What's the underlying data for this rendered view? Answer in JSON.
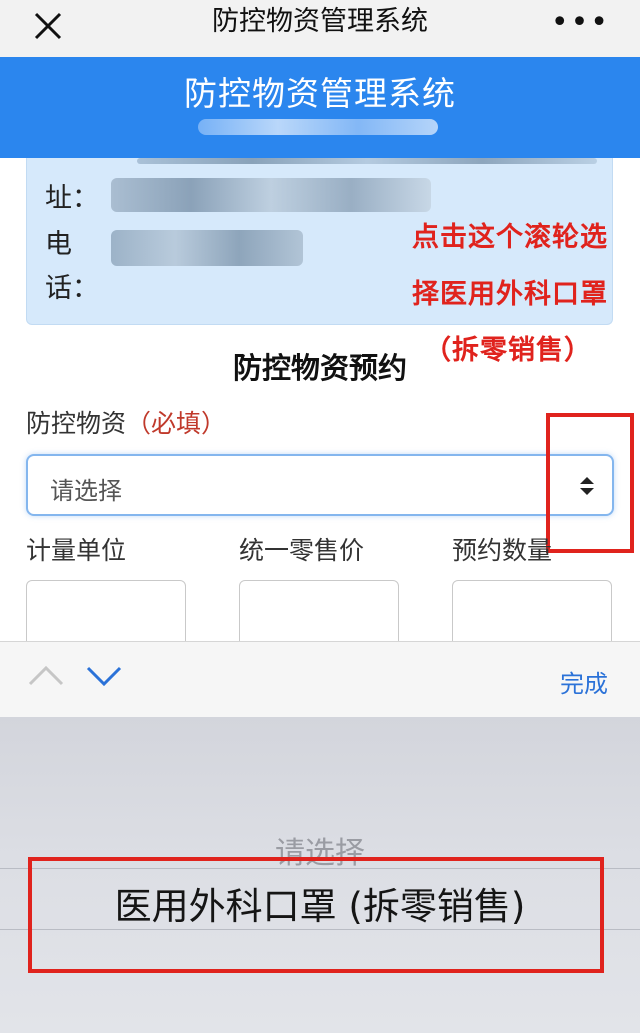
{
  "topbar": {
    "title": "防控物资管理系统",
    "more_label": "•••"
  },
  "header": {
    "title": "防控物资管理系统"
  },
  "card": {
    "labels": [
      "址：",
      "电",
      "话："
    ]
  },
  "annotation": {
    "lines": [
      "点击这个滚轮选",
      "择医用外科口罩",
      "（拆零销售）"
    ],
    "color": "#e0231d"
  },
  "form": {
    "section_title": "防控物资预约",
    "field_label": "防控物资",
    "required_label": "（必填）",
    "select_value": "请选择",
    "columns": [
      "计量单位",
      "统一零售价",
      "预约数量"
    ]
  },
  "picker": {
    "done_label": "完成",
    "options": [
      "请选择",
      "医用外科口罩 (拆零销售)"
    ],
    "selected_index": 1
  },
  "colors": {
    "accent": "#2b86ee",
    "link": "#2b72d8",
    "highlight": "#e0231d"
  }
}
